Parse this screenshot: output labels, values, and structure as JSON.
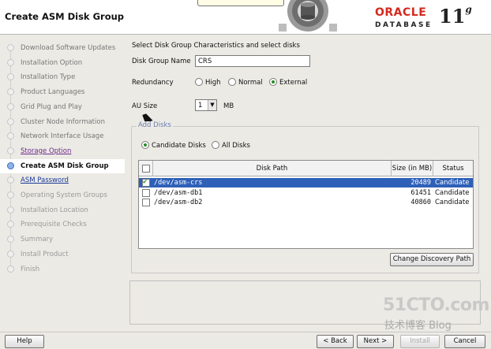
{
  "header": {
    "title": "Create ASM Disk Group",
    "oracle_logo": "ORACLE",
    "database_logo": "DATABASE",
    "version": "11",
    "version_sup": "g"
  },
  "nav": {
    "items": [
      {
        "label": "Download Software Updates",
        "state": "done"
      },
      {
        "label": "Installation Option",
        "state": "done"
      },
      {
        "label": "Installation Type",
        "state": "done"
      },
      {
        "label": "Product Languages",
        "state": "done"
      },
      {
        "label": "Grid Plug and Play",
        "state": "done"
      },
      {
        "label": "Cluster Node Information",
        "state": "done"
      },
      {
        "label": "Network Interface Usage",
        "state": "done"
      },
      {
        "label": "Storage Option",
        "state": "link"
      },
      {
        "label": "Create ASM Disk Group",
        "state": "current"
      },
      {
        "label": "ASM Password",
        "state": "link2"
      },
      {
        "label": "Operating System Groups",
        "state": "todo"
      },
      {
        "label": "Installation Location",
        "state": "todo"
      },
      {
        "label": "Prerequisite Checks",
        "state": "todo"
      },
      {
        "label": "Summary",
        "state": "todo"
      },
      {
        "label": "Install Product",
        "state": "todo"
      },
      {
        "label": "Finish",
        "state": "todo"
      }
    ]
  },
  "form": {
    "instruction": "Select Disk Group Characteristics and select disks",
    "disk_group_name_label": "Disk Group Name",
    "disk_group_name_value": "CRS",
    "redundancy_label": "Redundancy",
    "redundancy_options": [
      "High",
      "Normal",
      "External"
    ],
    "redundancy_selected": "External",
    "au_size_label": "AU Size",
    "au_size_value": "1",
    "au_size_unit": "MB"
  },
  "add_disks": {
    "legend": "Add Disks",
    "filter_options": [
      "Candidate Disks",
      "All Disks"
    ],
    "filter_selected": "Candidate Disks",
    "columns": [
      "Disk Path",
      "Size (in MB)",
      "Status"
    ],
    "rows": [
      {
        "checked": true,
        "path": "/dev/asm-crs",
        "size": "20489",
        "status": "Candidate",
        "selected": true
      },
      {
        "checked": false,
        "path": "/dev/asm-db1",
        "size": "61451",
        "status": "Candidate",
        "selected": false
      },
      {
        "checked": false,
        "path": "/dev/asm-db2",
        "size": "40860",
        "status": "Candidate",
        "selected": false
      }
    ],
    "change_discovery_path_label": "Change Discovery Path"
  },
  "footer": {
    "help_label": "Help",
    "back_label": "< Back",
    "next_label": "Next >",
    "install_label": "Install",
    "cancel_label": "Cancel"
  },
  "watermark": {
    "line1": "51CTO.com",
    "line2": "技术博客 Blog"
  },
  "colors": {
    "selection": "#2e60b8",
    "oracle_red": "#d32a1e",
    "nav_link": "#6a2a8a"
  }
}
